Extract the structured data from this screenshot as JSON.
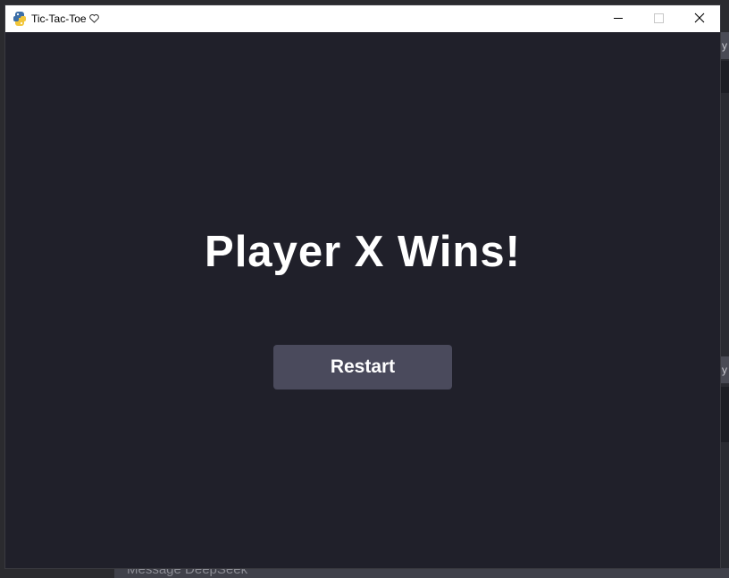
{
  "window": {
    "title": "Tic-Tac-Toe",
    "title_icon": "python-icon",
    "title_suffix_icon": "heart-icon",
    "controls": [
      "minimize-icon",
      "maximize-icon",
      "close-icon"
    ]
  },
  "game": {
    "message": "Player X Wins!",
    "restart_label": "Restart"
  },
  "background": {
    "tab_char_1": "y",
    "tab_char_2": "y",
    "chat_placeholder": "Message DeepSeek"
  },
  "colors": {
    "client_bg": "#20202a",
    "button_bg": "#4a4a5c",
    "text": "#ffffff"
  }
}
